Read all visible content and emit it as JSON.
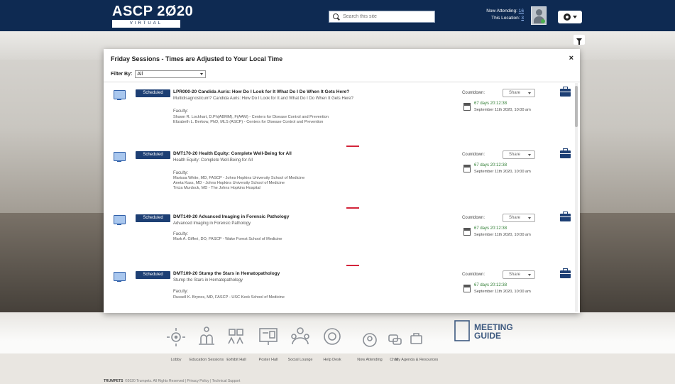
{
  "header": {
    "logo_main": "ASCP 2Ø20",
    "logo_sub": "VIRTUAL",
    "search_placeholder": "Search this site",
    "now_attending_label": "Now Attending:",
    "now_attending_count": "16",
    "this_location_label": "This Location:",
    "this_location_count": "3",
    "colors": {
      "header_bg": "#0e2a52",
      "badge": "#1d3f74",
      "accent_red": "#d3243a"
    }
  },
  "modal": {
    "title": "Friday Sessions - Times are Adjusted to Your Local Time",
    "close": "×",
    "filter_label": "Filter By:",
    "filter_value": "All",
    "sessions": [
      {
        "badge": "Scheduled",
        "title": "LPR000-20 Candida Auris: How Do I Look for It What Do I Do When It Gets Here?",
        "subtitle": "Multidisagnosticum? Candida Auris: How Do I Look for It and What Do I Do When It Gets Here?",
        "faculty_label": "Faculty:",
        "faculty": [
          "Shawn R. Lockhart, D.Ph(ABMM), F(AAM) - Centers for Disease Control and Prevention",
          "Elizabeth L. Berkow, PhD, MLS (ASCP) - Centers for Disease Control and Prevention"
        ],
        "countdown_label": "Countdown:",
        "share_label": "Share",
        "days": "67 days 20:12:38",
        "date": "September 11th 2020, 10:00 am"
      },
      {
        "badge": "Scheduled",
        "title": "DMT170-20 Health Equity: Complete Well-Being for All",
        "subtitle": "Health Equity: Complete Well-Being for All",
        "faculty_label": "Faculty:",
        "faculty": [
          "Marissa White, MD, FASCP - Johns Hopkins University School of Medicine",
          "Aneta Kass, MD - Johns Hopkins University School of Medicine",
          "Tricia Murdock, MD - The Johns Hopkins Hospital"
        ],
        "countdown_label": "Countdown:",
        "share_label": "Share",
        "days": "67 days 20:12:38",
        "date": "September 11th 2020, 10:00 am"
      },
      {
        "badge": "Scheduled",
        "title": "DMT149-20 Advanced Imaging in Forensic Pathology",
        "subtitle": "Advanced Imaging in Forensic Pathology",
        "faculty_label": "Faculty:",
        "faculty": [
          "Mark A. Gifferi, DO, FASCP - Wake Forest School of Medicine"
        ],
        "countdown_label": "Countdown:",
        "share_label": "Share",
        "days": "67 days 20:12:38",
        "date": "September 11th 2020, 10:00 am"
      },
      {
        "badge": "Scheduled",
        "title": "DMT109-20 Stump the Stars in Hematopathology",
        "subtitle": "Stump the Stars in Hematopathology",
        "faculty_label": "Faculty:",
        "faculty": [
          "Russell K. Brynes, MD, FASCP - USC Keck School of Medicine"
        ],
        "countdown_label": "Countdown:",
        "share_label": "Share",
        "days": "67 days 20:12:38",
        "date": "September 11th 2020, 10:00 am"
      }
    ]
  },
  "bottom_nav": {
    "items": [
      {
        "label": "Lobby",
        "icon": "lobby-icon"
      },
      {
        "label": "Education Sessions",
        "icon": "education-icon"
      },
      {
        "label": "Exhibit Hall",
        "icon": "exhibit-icon"
      },
      {
        "label": "Poster Hall",
        "icon": "poster-icon"
      },
      {
        "label": "Social Lounge",
        "icon": "lounge-icon"
      },
      {
        "label": "Help Desk",
        "icon": "help-icon"
      },
      {
        "label": "Now Attending",
        "icon": "people-icon"
      },
      {
        "label": "Chat",
        "icon": "chat-icon"
      },
      {
        "label": "My Agenda & Resources",
        "icon": "briefcase-icon"
      }
    ],
    "meeting_guide_line1": "MEETING",
    "meeting_guide_line2": "GUIDE"
  },
  "footer": {
    "brand": "TRUMPETS",
    "text": "©2020 Trumpets. All Rights Reserved  |  Privacy Policy  |  Technical Support"
  }
}
